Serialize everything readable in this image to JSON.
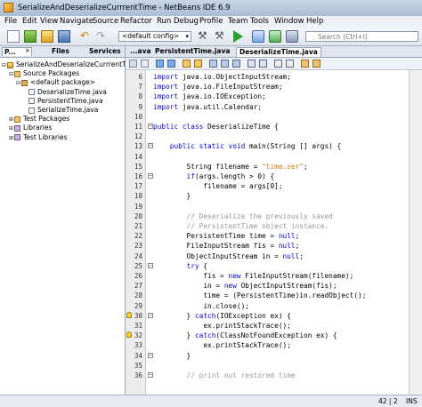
{
  "window": {
    "title": "SerializeAndDeserializeCurrrentTime - NetBeans IDE 6.9"
  },
  "menu": [
    "File",
    "Edit",
    "View",
    "Navigate",
    "Source",
    "Refactor",
    "Run",
    "Debug",
    "Profile",
    "Team",
    "Tools",
    "Window",
    "Help"
  ],
  "toolbar": {
    "config_value": "<default config>",
    "search_placeholder": "Search (Ctrl+I)"
  },
  "left_panel": {
    "tabs": [
      "P...",
      "Files",
      "Services"
    ],
    "tree": [
      {
        "label": "SerializeAndDeserializeCurrrentTime",
        "depth": 0,
        "icon": "project-icon"
      },
      {
        "label": "Source Packages",
        "depth": 1,
        "icon": "folder-icon"
      },
      {
        "label": "<default package>",
        "depth": 2,
        "icon": "package-icon"
      },
      {
        "label": "DeserializeTime.java",
        "depth": 3,
        "icon": "java-file-icon"
      },
      {
        "label": "PersistentTime.java",
        "depth": 3,
        "icon": "java-file-icon"
      },
      {
        "label": "SerializeTime.java",
        "depth": 3,
        "icon": "java-file-icon"
      },
      {
        "label": "Test Packages",
        "depth": 1,
        "icon": "folder-icon"
      },
      {
        "label": "Libraries",
        "depth": 1,
        "icon": "library-icon"
      },
      {
        "label": "Test Libraries",
        "depth": 1,
        "icon": "library-icon"
      }
    ]
  },
  "editor": {
    "tabs": [
      "...ava",
      "PersistentTime.java",
      "DeserializeTime.java"
    ],
    "active_tab": "DeserializeTime.java",
    "lines": [
      {
        "n": "6",
        "segs": [
          [
            "kw",
            "import"
          ],
          [
            "t",
            " java.io.ObjectInputStream;"
          ]
        ]
      },
      {
        "n": "7",
        "segs": [
          [
            "kw",
            "import"
          ],
          [
            "t",
            " java.io.FileInputStream;"
          ]
        ]
      },
      {
        "n": "8",
        "segs": [
          [
            "kw",
            "import"
          ],
          [
            "t",
            " java.io.IOException;"
          ]
        ]
      },
      {
        "n": "9",
        "segs": [
          [
            "kw",
            "import"
          ],
          [
            "t",
            " java.util.Calendar;"
          ]
        ]
      },
      {
        "n": "10",
        "segs": []
      },
      {
        "n": "11",
        "segs": [
          [
            "kw",
            "public class"
          ],
          [
            "t",
            " DeserializeTime "
          ],
          [
            "t",
            "{"
          ]
        ]
      },
      {
        "n": "12",
        "segs": []
      },
      {
        "n": "13",
        "segs": [
          [
            "t",
            "    "
          ],
          [
            "kw",
            "public static void"
          ],
          [
            "t",
            " main(String [] args) {"
          ]
        ]
      },
      {
        "n": "14",
        "segs": []
      },
      {
        "n": "15",
        "segs": [
          [
            "t",
            "        String filename = "
          ],
          [
            "str",
            "\"time.ser\""
          ],
          [
            "t",
            ";"
          ]
        ]
      },
      {
        "n": "16",
        "segs": [
          [
            "t",
            "        "
          ],
          [
            "kw",
            "if"
          ],
          [
            "t",
            "(args.length > "
          ],
          [
            "t",
            "0"
          ],
          [
            "t",
            ") {"
          ]
        ]
      },
      {
        "n": "17",
        "segs": [
          [
            "t",
            "            filename = args["
          ],
          [
            "t",
            "0"
          ],
          [
            "t",
            "];"
          ]
        ]
      },
      {
        "n": "18",
        "segs": [
          [
            "t",
            "        }"
          ]
        ]
      },
      {
        "n": "19",
        "segs": []
      },
      {
        "n": "20",
        "segs": [
          [
            "cm",
            "        // Deserialize the previously saved"
          ]
        ]
      },
      {
        "n": "21",
        "segs": [
          [
            "cm",
            "        // PersistentTime object instance."
          ]
        ]
      },
      {
        "n": "22",
        "segs": [
          [
            "t",
            "        PersistentTime time = "
          ],
          [
            "kw",
            "null"
          ],
          [
            "t",
            ";"
          ]
        ]
      },
      {
        "n": "23",
        "segs": [
          [
            "t",
            "        FileInputStream fis = "
          ],
          [
            "kw",
            "null"
          ],
          [
            "t",
            ";"
          ]
        ]
      },
      {
        "n": "24",
        "segs": [
          [
            "t",
            "        ObjectInputStream in = "
          ],
          [
            "kw",
            "null"
          ],
          [
            "t",
            ";"
          ]
        ]
      },
      {
        "n": "25",
        "segs": [
          [
            "t",
            "        "
          ],
          [
            "kw",
            "try"
          ],
          [
            "t",
            " {"
          ]
        ]
      },
      {
        "n": "26",
        "segs": [
          [
            "t",
            "            fis = "
          ],
          [
            "kw",
            "new"
          ],
          [
            "t",
            " FileInputStream(filename);"
          ]
        ]
      },
      {
        "n": "27",
        "segs": [
          [
            "t",
            "            in = "
          ],
          [
            "kw",
            "new"
          ],
          [
            "t",
            " ObjectInputStream(fis);"
          ]
        ]
      },
      {
        "n": "28",
        "segs": [
          [
            "t",
            "            time = (PersistentTime)in.readObject();"
          ]
        ]
      },
      {
        "n": "29",
        "segs": [
          [
            "t",
            "            in.close();"
          ]
        ]
      },
      {
        "n": "30",
        "segs": [
          [
            "t",
            "        } "
          ],
          [
            "kw",
            "catch"
          ],
          [
            "t",
            "(IOException ex) {"
          ]
        ]
      },
      {
        "n": "31",
        "segs": [
          [
            "t",
            "            ex.printStackTrace();"
          ]
        ]
      },
      {
        "n": "32",
        "segs": [
          [
            "t",
            "        } "
          ],
          [
            "kw",
            "catch"
          ],
          [
            "t",
            "(ClassNotFoundException ex) {"
          ]
        ]
      },
      {
        "n": "33",
        "segs": [
          [
            "t",
            "            ex.printStackTrace();"
          ]
        ]
      },
      {
        "n": "34",
        "segs": [
          [
            "t",
            "        }"
          ]
        ]
      },
      {
        "n": "35",
        "segs": []
      },
      {
        "n": "36",
        "segs": [
          [
            "cm",
            "        // print out restored time"
          ]
        ]
      }
    ]
  },
  "status": {
    "position": "42 | 2",
    "mode": "INS"
  }
}
